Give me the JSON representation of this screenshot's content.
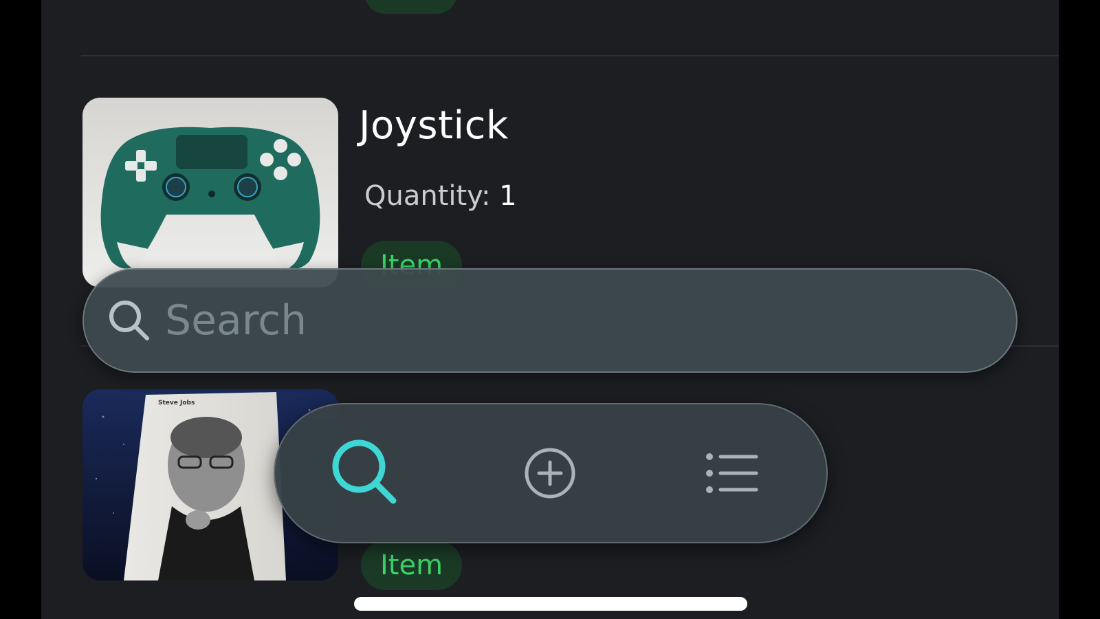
{
  "items": [
    {
      "name": "Joystick",
      "quantity_label": "Quantity:",
      "quantity": "1",
      "tag": "Item",
      "image_icon": "gamepad-photo"
    },
    {
      "name": "",
      "tag": "Item",
      "image_icon": "book-photo"
    }
  ],
  "search": {
    "placeholder": "Search",
    "icon": "search-icon"
  },
  "tabbar": {
    "tabs": [
      {
        "icon": "search-icon",
        "active": true
      },
      {
        "icon": "add-circle-icon",
        "active": false
      },
      {
        "icon": "list-icon",
        "active": false
      }
    ],
    "active_color": "#3fd6d6",
    "inactive_color": "#aab3b7"
  },
  "colors": {
    "background": "#1c1e22",
    "tag_text": "#3bd46a",
    "tag_background": "#1b3a26"
  }
}
